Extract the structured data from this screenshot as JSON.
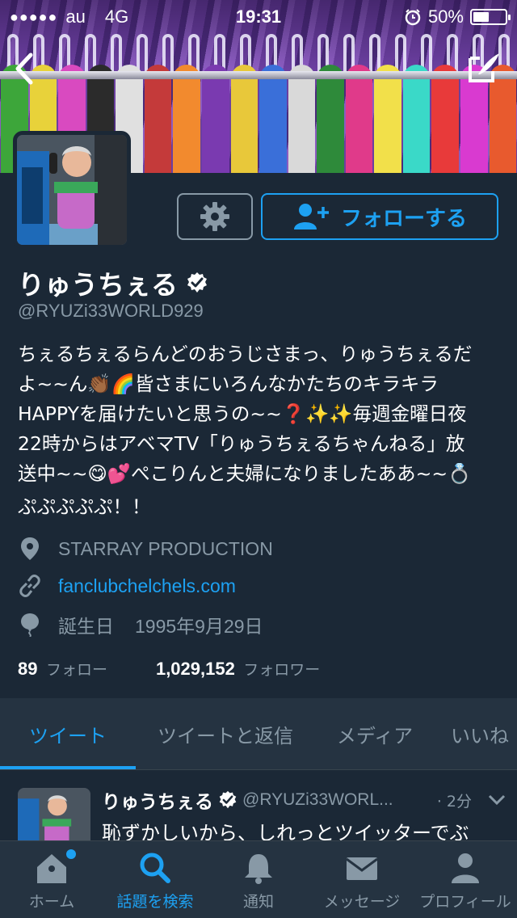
{
  "status_bar": {
    "signal": "●●●●●",
    "carrier": "au",
    "network": "4G",
    "time": "19:31",
    "battery_percent": "50%",
    "battery_level": 0.5
  },
  "profile": {
    "name": "りゅうちぇる",
    "verified": true,
    "handle": "@RYUZi33WORLD929",
    "bio_lines": [
      "ちぇるちぇるらんどのおうじさまっ、りゅうちぇるだ",
      "よ~~ん👏🏾🌈皆さまにいろんなかたちのキラキラ",
      "HAPPYを届けたいと思うの~~❓✨✨毎週金曜日夜",
      "22時からはアベマTV「りゅうちぇるちゃんねる」放",
      "送中~~😋💕ぺこりんと夫婦になりましたああ~~💍",
      "ぷぷぷぷぷ！！"
    ],
    "location": "STARRAY PRODUCTION",
    "website": "fanclubchelchels.com",
    "birthday_label": "誕生日",
    "birthday_value": "1995年9月29日",
    "following_count": "89",
    "following_label": "フォロー",
    "followers_count": "1,029,152",
    "followers_label": "フォロワー"
  },
  "actions": {
    "settings_icon": "gear-icon",
    "follow_label": "フォローする"
  },
  "tabs": [
    {
      "label": "ツイート",
      "active": true
    },
    {
      "label": "ツイートと返信",
      "active": false
    },
    {
      "label": "メディア",
      "active": false
    },
    {
      "label": "いいね",
      "active": false
    }
  ],
  "tweet": {
    "name": "りゅうちぇる",
    "handle": "@RYUZi33WORL...",
    "time": "· 2分",
    "text": "恥ずかしいから、しれっとツイッターでぶ"
  },
  "bottom_nav": [
    {
      "label": "ホーム",
      "icon": "home-icon",
      "active": false,
      "badge": true
    },
    {
      "label": "話題を検索",
      "icon": "search-icon",
      "active": true,
      "badge": false
    },
    {
      "label": "通知",
      "icon": "bell-icon",
      "active": false,
      "badge": false
    },
    {
      "label": "メッセージ",
      "icon": "envelope-icon",
      "active": false,
      "badge": false
    },
    {
      "label": "プロフィール",
      "icon": "person-icon",
      "active": false,
      "badge": false
    }
  ],
  "colors": {
    "background": "#1b2836",
    "accent": "#1da1f2",
    "muted": "#8899a6",
    "nav_background": "#253341"
  }
}
